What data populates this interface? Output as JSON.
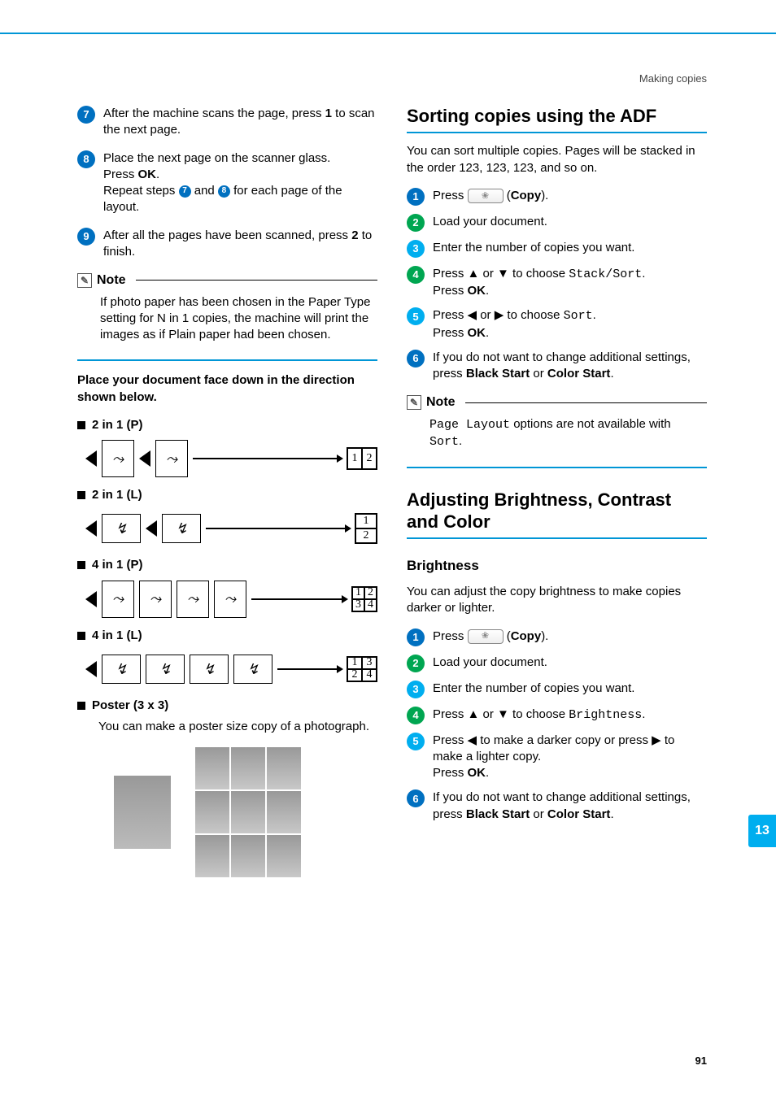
{
  "running_head": "Making copies",
  "left": {
    "step7": {
      "n": "7",
      "text_a": "After the machine scans the page, press ",
      "text_b": " to scan the next page.",
      "bold": "1"
    },
    "step8": {
      "n": "8",
      "line1": "Place the next page on the scanner glass.",
      "line2a": "Press ",
      "line2b": "OK",
      "line2c": ".",
      "line3a": "Repeat steps ",
      "line3b": " and ",
      "line3c": " for each page of the layout.",
      "mini7": "7",
      "mini8": "8"
    },
    "step9": {
      "n": "9",
      "text_a": "After all the pages have been scanned, press ",
      "bold": "2",
      "text_b": " to finish."
    },
    "note_title": "Note",
    "note_body": "If photo paper has been chosen in the Paper Type setting for N in 1 copies, the machine will print the images as if Plain paper had been chosen.",
    "place_doc": "Place your document face down in the direction shown below.",
    "opts": {
      "o1": "2 in 1 (P)",
      "o2": "2 in 1 (L)",
      "o3": "4 in 1 (P)",
      "o4": "4 in 1 (L)",
      "o5": "Poster (3 x 3)"
    },
    "poster_text": "You can make a poster size copy of a photograph.",
    "digits": {
      "d1": "1",
      "d2": "2",
      "d3": "3",
      "d4": "4"
    }
  },
  "right": {
    "h_sort": "Sorting copies using the ADF",
    "sort_intro": "You can sort multiple copies. Pages will be stacked in the order 123, 123, 123, and so on.",
    "s1": {
      "n": "1",
      "a": "Press ",
      "b": " (",
      "c": "Copy",
      "d": ")."
    },
    "s2": {
      "n": "2",
      "t": "Load your document."
    },
    "s3": {
      "n": "3",
      "t": "Enter the number of copies you want."
    },
    "s4": {
      "n": "4",
      "a": "Press ▲ or ▼ to choose ",
      "mono": "Stack/Sort",
      "b": ".",
      "c": "Press ",
      "ok": "OK",
      "d": "."
    },
    "s5": {
      "n": "5",
      "a": "Press ◀ or ▶ to choose ",
      "mono": "Sort",
      "b": ".",
      "c": "Press ",
      "ok": "OK",
      "d": "."
    },
    "s6": {
      "n": "6",
      "a": "If you do not want to change additional settings, press ",
      "bs": "Black Start",
      "b": " or ",
      "cs": "Color Start",
      "c": "."
    },
    "note_title": "Note",
    "note_body_a": "Page Layout",
    "note_body_b": " options are not available with ",
    "note_body_c": "Sort",
    "note_body_d": ".",
    "h_adj": "Adjusting Brightness, Contrast and Color",
    "h_bright": "Brightness",
    "bright_intro": "You can adjust the copy brightness to make copies darker or lighter.",
    "b1": {
      "n": "1",
      "a": "Press ",
      "b": " (",
      "c": "Copy",
      "d": ")."
    },
    "b2": {
      "n": "2",
      "t": "Load your document."
    },
    "b3": {
      "n": "3",
      "t": "Enter the number of copies you want."
    },
    "b4": {
      "n": "4",
      "a": "Press ▲ or ▼ to choose ",
      "mono": "Brightness",
      "b": "."
    },
    "b5": {
      "n": "5",
      "a": "Press ◀ to make a darker copy or press ▶ to make a lighter copy.",
      "c": "Press ",
      "ok": "OK",
      "d": "."
    },
    "b6": {
      "n": "6",
      "a": "If you do not want to change additional settings, press ",
      "bs": "Black Start",
      "b": " or ",
      "cs": "Color Start",
      "c": "."
    }
  },
  "tab": "13",
  "page_num": "91"
}
